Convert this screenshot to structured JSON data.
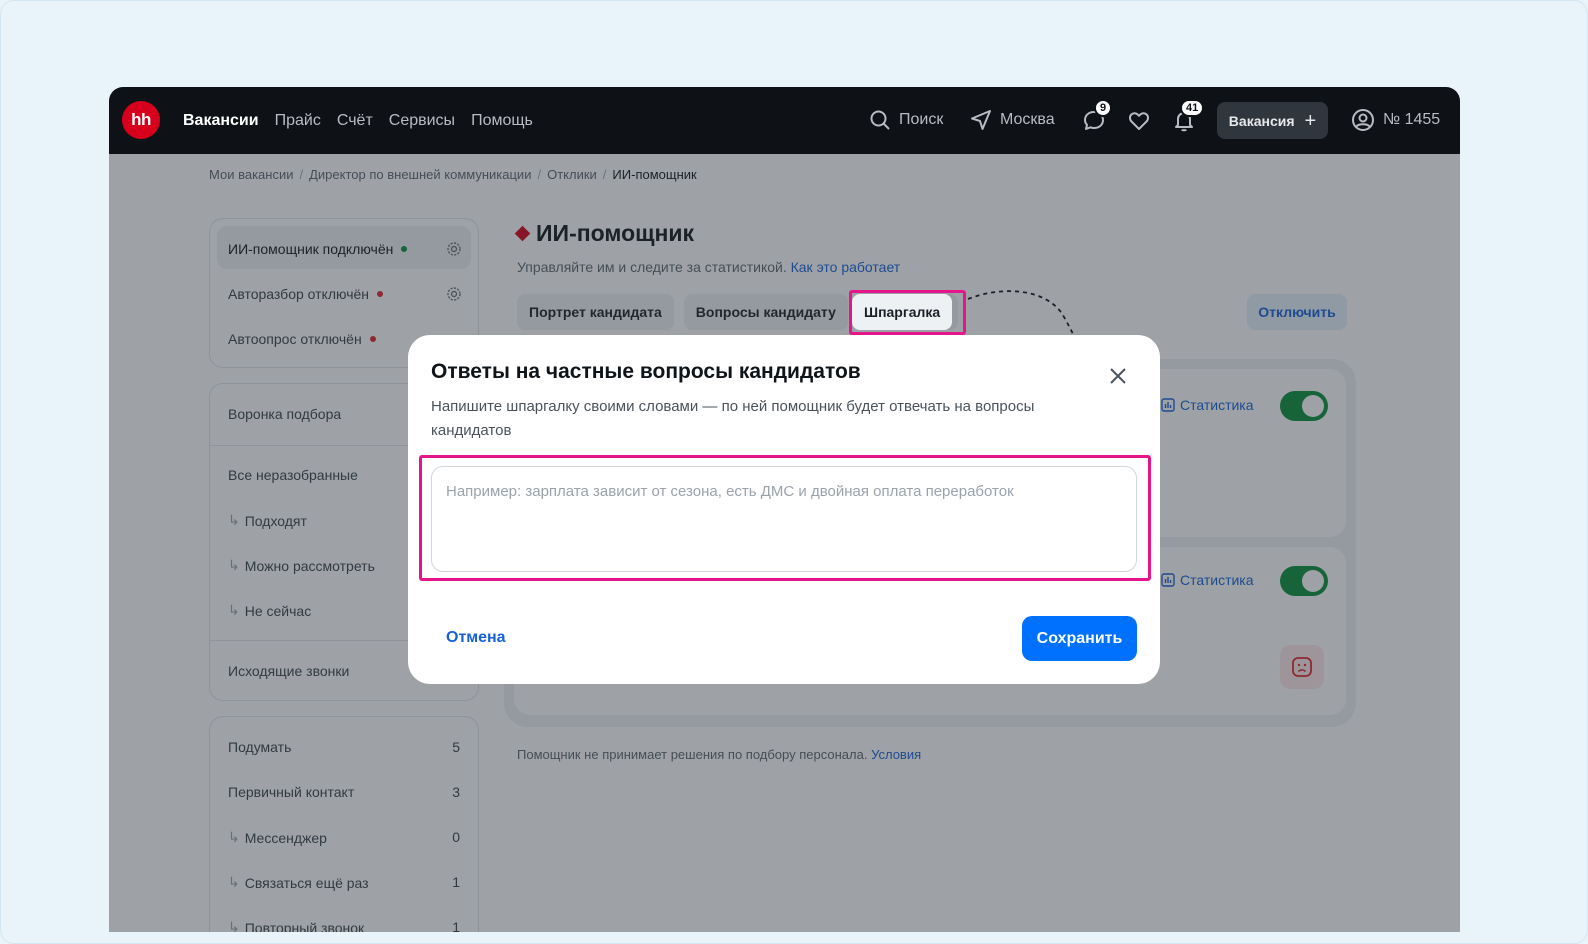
{
  "header": {
    "logo": "hh",
    "nav": [
      "Вакансии",
      "Прайс",
      "Счёт",
      "Сервисы",
      "Помощь"
    ],
    "search_label": "Поиск",
    "city": "Москва",
    "messages_count": "9",
    "notifications_count": "41",
    "vacancy_button": "Вакансия",
    "account": "№ 1455"
  },
  "breadcrumbs": [
    "Мои вакансии",
    "Директор по внешней коммуникации",
    "Отклики",
    "ИИ-помощник"
  ],
  "sidebar": {
    "status_items": [
      {
        "label": "ИИ-помощник подключён",
        "dot_color": "#0a8f3c"
      },
      {
        "label": "Авторазбор отключён",
        "dot_color": "#e0252b"
      },
      {
        "label": "Автоопрос отключён",
        "dot_color": "#e0252b"
      }
    ],
    "funnel_title": "Воронка подбора",
    "funnel_items": [
      {
        "label": "Все неразобранные",
        "sub": false
      },
      {
        "label": "Подходят",
        "sub": true
      },
      {
        "label": "Можно рассмотреть",
        "sub": true
      },
      {
        "label": "Не сейчас",
        "sub": true
      }
    ],
    "calls_label": "Исходящие звонки",
    "stages": [
      {
        "label": "Подумать",
        "count": "5",
        "sub": false
      },
      {
        "label": "Первичный контакт",
        "count": "3",
        "sub": false
      },
      {
        "label": "Мессенджер",
        "count": "0",
        "sub": true
      },
      {
        "label": "Связаться ещё раз",
        "count": "1",
        "sub": true
      },
      {
        "label": "Повторный звонок",
        "count": "1",
        "sub": true
      }
    ]
  },
  "main": {
    "title": "ИИ-помощник",
    "subtitle": "Управляйте им и следите за статистикой.",
    "subtitle_link": "Как это работает",
    "tabs": [
      "Портрет кандидата",
      "Вопросы кандидату",
      "Шпаргалка"
    ],
    "disable_button": "Отключить",
    "stat_label": "Статистика",
    "footnote": "Помощник не принимает решения по подбору персонала.",
    "footnote_link": "Условия"
  },
  "modal": {
    "title": "Ответы на частные вопросы кандидатов",
    "description": "Напишите шпаргалку своими словами — по ней помощник будет отвечать на вопросы кандидатов",
    "placeholder": "Например: зарплата зависит от сезона, есть ДМС и двойная оплата переработок",
    "cancel": "Отмена",
    "save": "Сохранить"
  },
  "colors": {
    "highlight": "#e5168b",
    "primary": "#0070ff",
    "brand": "#d6001c"
  }
}
